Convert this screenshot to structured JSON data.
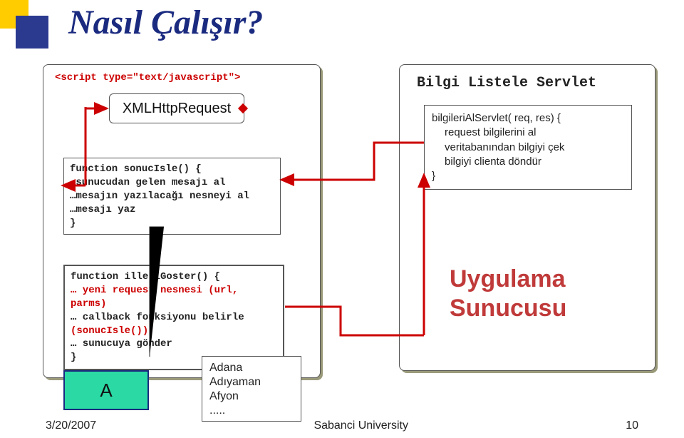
{
  "title": "Nasıl Çalışır?",
  "left": {
    "script_tag": "<script type=\"text/javascript\">",
    "xmlrq": "XMLHttpRequest",
    "box1": {
      "l1": "function sonucIsle() {",
      "l2": "…sunucudan gelen mesajı al",
      "l3": "…mesajın yazılacağı nesneyi al",
      "l4": "…mesajı yaz",
      "l5": "}"
    },
    "box2": {
      "l1": "function illeriGoster() {",
      "l2": "… yeni request nesnesi (url, parms)",
      "l3": "… callback fonksiyonu belirle",
      "l4": "(sonucIsle())",
      "l5": "… sunucuya gönder",
      "l6": "}"
    },
    "abox": "A",
    "cities": {
      "c1": "Adana",
      "c2": "Adıyaman",
      "c3": "Afyon",
      "c4": "....."
    }
  },
  "right": {
    "title": "Bilgi Listele Servlet",
    "servlet": {
      "l1": "bilgileriAlServlet( req, res) {",
      "l2": "request bilgilerini al",
      "l3": "veritabanından bilgiyi çek",
      "l4": "bilgiyi clienta  döndür",
      "l5": "}"
    },
    "app": {
      "l1": "Uygulama",
      "l2": "Sunucusu"
    }
  },
  "footer": {
    "date": "3/20/2007",
    "place": "Sabanci University",
    "page": "10"
  }
}
